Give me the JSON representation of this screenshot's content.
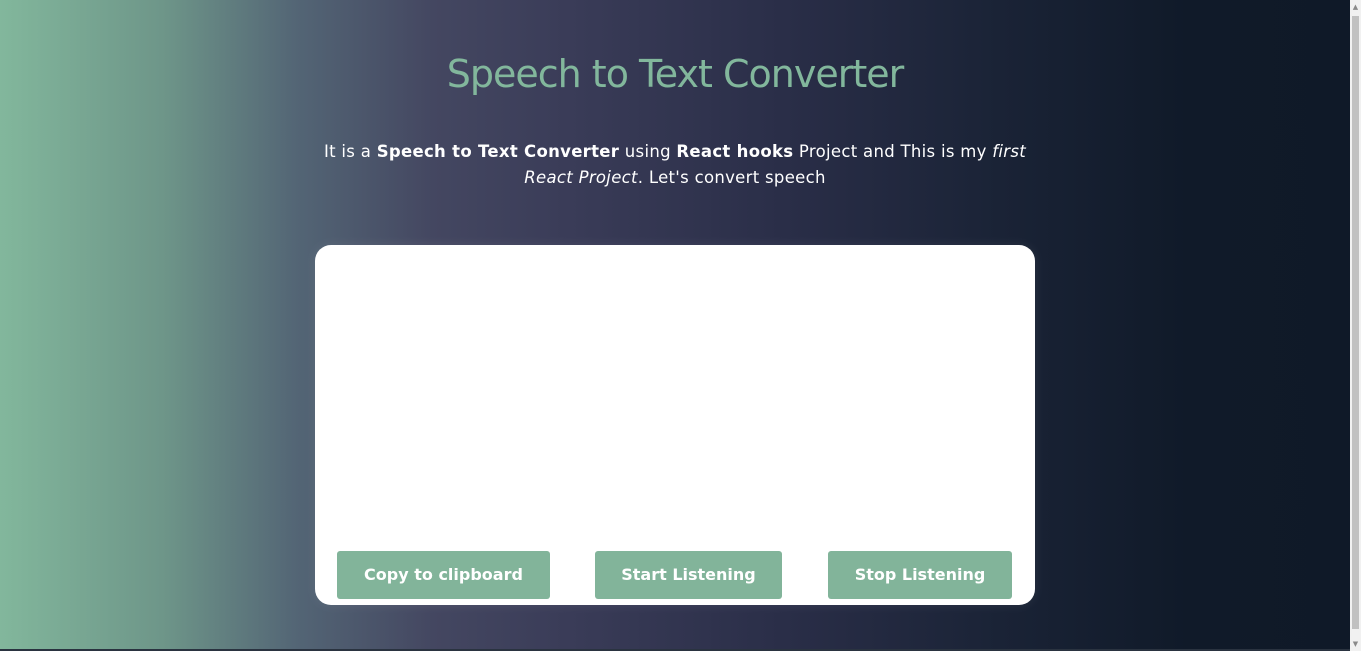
{
  "header": {
    "title": "Speech to Text Converter"
  },
  "description": {
    "part1": "It is a ",
    "bold1": "Speech to Text Converter",
    "part2": " using ",
    "bold2": "React hooks",
    "part3": " Project and This is my ",
    "italic1": "first React Project",
    "part4": ". Let's convert speech"
  },
  "transcript": {
    "text": ""
  },
  "buttons": {
    "copy": "Copy to clipboard",
    "start": "Start Listening",
    "stop": "Stop Listening"
  },
  "colors": {
    "accent": "#82b79c",
    "card": "#ffffff",
    "text": "#ffffff"
  }
}
